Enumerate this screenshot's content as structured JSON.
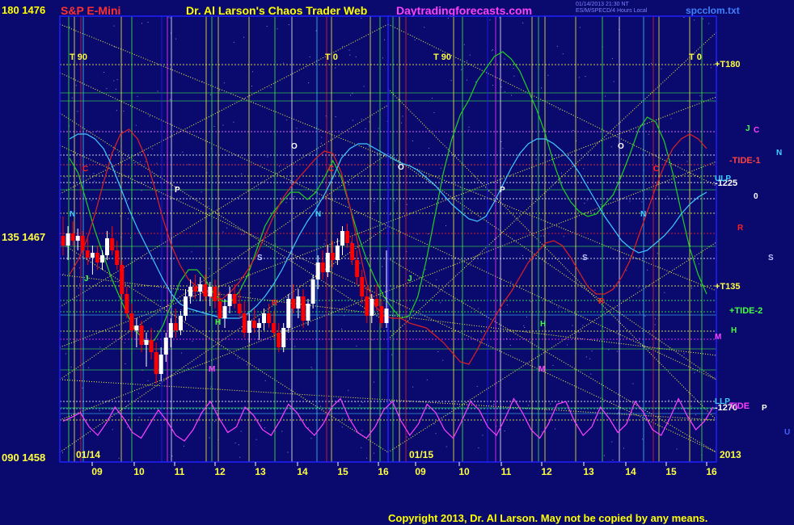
{
  "header": {
    "price_top": "180  1476",
    "instrument": "S&P E-Mini",
    "title": "Dr. Al Larson's Chaos Trader Web",
    "site": "Daytradingforecasts.com",
    "stamp_line1": "01/14/2013 21:30 NT",
    "stamp_line2": "ES/M/SPECD/4 Hours Local",
    "file": "spcclom.txt"
  },
  "footer": {
    "copyright": "Copyright 2013, Dr. Al Larson. May not be copied by any means."
  },
  "colors": {
    "background": "#0a0a6e",
    "bull_candle": "#ffffff",
    "bear_candle": "#ff0000",
    "grid_yellow": "#ffff40",
    "green_line": "#20d020",
    "red_line": "#e02020",
    "cyan_line": "#40c8ff",
    "magenta_osc": "#ff40ff"
  },
  "chart_data": {
    "type": "line",
    "left_axis": {
      "labels": [
        {
          "text": "180  1476",
          "value": 1476
        },
        {
          "text": "135  1467",
          "value": 1467
        },
        {
          "text": "090  1458",
          "value": 1458
        }
      ],
      "ylim": [
        1458,
        1476
      ]
    },
    "x_ticks": [
      "09",
      "10",
      "11",
      "12",
      "13",
      "14",
      "15",
      "16",
      "09",
      "10",
      "11",
      "12",
      "13",
      "14",
      "15",
      "16"
    ],
    "date_labels": [
      "01/14",
      "01/15"
    ],
    "year_label": "2013",
    "top_markers": [
      "T  90",
      "T  0",
      "T  90",
      "T  0"
    ],
    "right_levels": [
      {
        "label": "+T180",
        "color": "#ffff40"
      },
      {
        "label": "-TIDE-1",
        "color": "#ff4040"
      },
      {
        "label": "-1225",
        "color": "#ffffff"
      },
      {
        "label": "+T135",
        "color": "#ffff40"
      },
      {
        "label": "+TIDE-2",
        "color": "#40ff40"
      },
      {
        "label": "-1270",
        "color": "#ffffff"
      },
      {
        "label": "TIDE",
        "color": "#ff40ff"
      }
    ],
    "planet_labels_right": [
      {
        "text": "J",
        "color": "#40ff40"
      },
      {
        "text": "C",
        "color": "#ff40ff"
      },
      {
        "text": "N",
        "color": "#40d0ff"
      },
      {
        "text": "ULP",
        "color": "#40d0ff"
      },
      {
        "text": "0",
        "color": "#ffffff"
      },
      {
        "text": "R",
        "color": "#ff2020"
      },
      {
        "text": "S",
        "color": "#c0c0ff"
      },
      {
        "text": "H",
        "color": "#40ff40"
      },
      {
        "text": "M",
        "color": "#ff40ff"
      },
      {
        "text": "LLP",
        "color": "#40d0ff"
      },
      {
        "text": "P",
        "color": "#ffffff"
      },
      {
        "text": "U",
        "color": "#4060ff"
      }
    ],
    "chart_labels": [
      {
        "text": "C",
        "color": "#ff2020"
      },
      {
        "text": "P",
        "color": "#ffffff"
      },
      {
        "text": "N",
        "color": "#40d0ff"
      },
      {
        "text": "J",
        "color": "#40ff40"
      },
      {
        "text": "S",
        "color": "#c0c0ff"
      },
      {
        "text": "O",
        "color": "#ffffff"
      },
      {
        "text": "H",
        "color": "#40ff40"
      },
      {
        "text": "M",
        "color": "#ff40ff"
      },
      {
        "text": "R",
        "color": "#ff2020"
      },
      {
        "text": "C",
        "color": "#ff2020"
      },
      {
        "text": "N",
        "color": "#40d0ff"
      },
      {
        "text": "O",
        "color": "#ffffff"
      },
      {
        "text": "P",
        "color": "#ffffff"
      },
      {
        "text": "J",
        "color": "#40ff40"
      },
      {
        "text": "S",
        "color": "#c0c0ff"
      },
      {
        "text": "R",
        "color": "#ff2020"
      },
      {
        "text": "H",
        "color": "#40ff40"
      },
      {
        "text": "M",
        "color": "#ff40ff"
      },
      {
        "text": "O",
        "color": "#ffffff"
      },
      {
        "text": "N",
        "color": "#40d0ff"
      },
      {
        "text": "C",
        "color": "#ff2020"
      }
    ],
    "candles": [
      {
        "o": 1467.0,
        "h": 1467.8,
        "l": 1466.2,
        "c": 1466.6
      },
      {
        "o": 1466.6,
        "h": 1467.4,
        "l": 1466.0,
        "c": 1467.1
      },
      {
        "o": 1467.1,
        "h": 1467.6,
        "l": 1466.6,
        "c": 1466.8
      },
      {
        "o": 1466.8,
        "h": 1467.3,
        "l": 1466.4,
        "c": 1467.0
      },
      {
        "o": 1467.0,
        "h": 1467.2,
        "l": 1466.2,
        "c": 1466.4
      },
      {
        "o": 1466.4,
        "h": 1466.9,
        "l": 1465.8,
        "c": 1466.1
      },
      {
        "o": 1466.1,
        "h": 1466.6,
        "l": 1465.4,
        "c": 1466.3
      },
      {
        "o": 1466.3,
        "h": 1466.6,
        "l": 1465.6,
        "c": 1465.9
      },
      {
        "o": 1465.9,
        "h": 1466.4,
        "l": 1465.6,
        "c": 1466.2
      },
      {
        "o": 1466.2,
        "h": 1467.2,
        "l": 1466.0,
        "c": 1466.9
      },
      {
        "o": 1466.9,
        "h": 1467.4,
        "l": 1466.2,
        "c": 1466.4
      },
      {
        "o": 1466.4,
        "h": 1466.8,
        "l": 1465.6,
        "c": 1465.8
      },
      {
        "o": 1465.8,
        "h": 1466.0,
        "l": 1464.4,
        "c": 1464.6
      },
      {
        "o": 1464.6,
        "h": 1464.9,
        "l": 1463.6,
        "c": 1463.8
      },
      {
        "o": 1463.8,
        "h": 1464.2,
        "l": 1462.8,
        "c": 1463.1
      },
      {
        "o": 1463.1,
        "h": 1463.6,
        "l": 1462.4,
        "c": 1463.3
      },
      {
        "o": 1463.3,
        "h": 1463.5,
        "l": 1462.2,
        "c": 1462.5
      },
      {
        "o": 1462.5,
        "h": 1463.0,
        "l": 1461.6,
        "c": 1462.7
      },
      {
        "o": 1462.7,
        "h": 1463.2,
        "l": 1461.9,
        "c": 1462.2
      },
      {
        "o": 1462.2,
        "h": 1462.6,
        "l": 1460.9,
        "c": 1461.3
      },
      {
        "o": 1461.3,
        "h": 1462.4,
        "l": 1461.0,
        "c": 1462.1
      },
      {
        "o": 1462.1,
        "h": 1463.0,
        "l": 1461.8,
        "c": 1462.8
      },
      {
        "o": 1462.8,
        "h": 1463.6,
        "l": 1462.4,
        "c": 1463.4
      },
      {
        "o": 1463.4,
        "h": 1464.0,
        "l": 1462.8,
        "c": 1463.1
      },
      {
        "o": 1463.1,
        "h": 1463.9,
        "l": 1462.9,
        "c": 1463.7
      },
      {
        "o": 1463.7,
        "h": 1464.8,
        "l": 1463.5,
        "c": 1464.5
      },
      {
        "o": 1464.5,
        "h": 1465.2,
        "l": 1464.2,
        "c": 1464.9
      },
      {
        "o": 1464.9,
        "h": 1465.4,
        "l": 1464.4,
        "c": 1464.7
      },
      {
        "o": 1464.7,
        "h": 1465.3,
        "l": 1464.3,
        "c": 1465.0
      },
      {
        "o": 1465.0,
        "h": 1465.4,
        "l": 1464.3,
        "c": 1464.5
      },
      {
        "o": 1464.5,
        "h": 1465.1,
        "l": 1464.1,
        "c": 1464.9
      },
      {
        "o": 1464.9,
        "h": 1465.2,
        "l": 1464.0,
        "c": 1464.3
      },
      {
        "o": 1464.3,
        "h": 1464.7,
        "l": 1463.4,
        "c": 1463.6
      },
      {
        "o": 1463.6,
        "h": 1464.4,
        "l": 1463.2,
        "c": 1464.1
      },
      {
        "o": 1464.1,
        "h": 1464.9,
        "l": 1463.8,
        "c": 1464.6
      },
      {
        "o": 1464.6,
        "h": 1465.0,
        "l": 1464.0,
        "c": 1464.2
      },
      {
        "o": 1464.2,
        "h": 1464.8,
        "l": 1463.6,
        "c": 1463.8
      },
      {
        "o": 1463.8,
        "h": 1464.3,
        "l": 1462.8,
        "c": 1463.0
      },
      {
        "o": 1463.0,
        "h": 1463.8,
        "l": 1462.6,
        "c": 1463.5
      },
      {
        "o": 1463.5,
        "h": 1464.0,
        "l": 1463.0,
        "c": 1463.2
      },
      {
        "o": 1463.2,
        "h": 1463.6,
        "l": 1462.7,
        "c": 1463.4
      },
      {
        "o": 1463.4,
        "h": 1464.0,
        "l": 1463.1,
        "c": 1463.8
      },
      {
        "o": 1463.8,
        "h": 1464.2,
        "l": 1463.2,
        "c": 1463.4
      },
      {
        "o": 1463.4,
        "h": 1463.9,
        "l": 1462.8,
        "c": 1463.0
      },
      {
        "o": 1463.0,
        "h": 1463.4,
        "l": 1462.2,
        "c": 1462.4
      },
      {
        "o": 1462.4,
        "h": 1463.4,
        "l": 1462.2,
        "c": 1463.2
      },
      {
        "o": 1463.2,
        "h": 1464.6,
        "l": 1463.0,
        "c": 1464.4
      },
      {
        "o": 1464.4,
        "h": 1465.0,
        "l": 1463.8,
        "c": 1464.0
      },
      {
        "o": 1464.0,
        "h": 1464.8,
        "l": 1463.6,
        "c": 1464.5
      },
      {
        "o": 1464.5,
        "h": 1464.8,
        "l": 1463.2,
        "c": 1463.5
      },
      {
        "o": 1463.5,
        "h": 1464.4,
        "l": 1463.3,
        "c": 1464.2
      },
      {
        "o": 1464.2,
        "h": 1465.4,
        "l": 1464.0,
        "c": 1465.2
      },
      {
        "o": 1465.2,
        "h": 1466.2,
        "l": 1464.8,
        "c": 1465.9
      },
      {
        "o": 1465.9,
        "h": 1466.4,
        "l": 1465.2,
        "c": 1465.5
      },
      {
        "o": 1465.5,
        "h": 1466.6,
        "l": 1465.3,
        "c": 1466.3
      },
      {
        "o": 1466.3,
        "h": 1466.8,
        "l": 1465.7,
        "c": 1466.0
      },
      {
        "o": 1466.0,
        "h": 1466.9,
        "l": 1465.8,
        "c": 1466.6
      },
      {
        "o": 1466.6,
        "h": 1467.4,
        "l": 1466.2,
        "c": 1467.2
      },
      {
        "o": 1467.2,
        "h": 1467.5,
        "l": 1466.5,
        "c": 1466.7
      },
      {
        "o": 1466.7,
        "h": 1467.0,
        "l": 1465.8,
        "c": 1466.0
      },
      {
        "o": 1466.0,
        "h": 1466.4,
        "l": 1465.0,
        "c": 1465.3
      },
      {
        "o": 1465.3,
        "h": 1465.6,
        "l": 1464.2,
        "c": 1464.5
      },
      {
        "o": 1464.5,
        "h": 1464.9,
        "l": 1463.4,
        "c": 1463.7
      },
      {
        "o": 1463.7,
        "h": 1464.6,
        "l": 1463.4,
        "c": 1464.4
      },
      {
        "o": 1464.4,
        "h": 1465.0,
        "l": 1463.9,
        "c": 1464.1
      },
      {
        "o": 1464.1,
        "h": 1464.4,
        "l": 1463.2,
        "c": 1463.4
      },
      {
        "o": 1463.4,
        "h": 1466.4,
        "l": 1463.2,
        "c": 1464.0
      }
    ],
    "series": [
      {
        "color": "#20d020",
        "values": [
          1470.2,
          1469.6,
          1468.4,
          1467.2,
          1466.2,
          1465.2,
          1464.4,
          1463.6,
          1463.0,
          1462.6,
          1462.7,
          1463.3,
          1464.2,
          1465.1,
          1465.6,
          1465.6,
          1465.2,
          1464.6,
          1464.3,
          1464.3,
          1464.7,
          1465.4,
          1466.4,
          1467.4,
          1468.0,
          1468.4,
          1468.8,
          1468.8,
          1468.5,
          1468.8,
          1469.4,
          1470.1,
          1469.4,
          1468.2,
          1467.0,
          1466.0,
          1465.2,
          1464.5,
          1464.0,
          1463.6,
          1463.7,
          1464.5,
          1466.0,
          1467.8,
          1469.6,
          1471.0,
          1472.0,
          1472.6,
          1473.4,
          1473.9,
          1474.4,
          1474.6,
          1474.3,
          1473.8,
          1473.0,
          1472.2,
          1471.2,
          1470.0,
          1469.0,
          1468.4,
          1468.0,
          1467.8,
          1467.9,
          1468.3,
          1468.7,
          1469.5,
          1470.4,
          1471.4,
          1471.9,
          1471.7,
          1470.9,
          1469.6,
          1468.0,
          1466.5,
          1465.4,
          1464.6
        ]
      },
      {
        "color": "#e02020",
        "values": [
          1465.4,
          1466.0,
          1466.8,
          1467.9,
          1469.2,
          1470.4,
          1471.2,
          1471.4,
          1471.0,
          1470.2,
          1469.0,
          1467.7,
          1466.6,
          1465.8,
          1465.2,
          1464.9,
          1464.6,
          1464.4,
          1464.4,
          1464.7,
          1465.1,
          1465.6,
          1466.2,
          1467.0,
          1467.8,
          1468.5,
          1469.0,
          1469.4,
          1469.8,
          1470.2,
          1470.5,
          1470.4,
          1469.6,
          1468.2,
          1466.6,
          1465.0,
          1464.1,
          1463.7,
          1463.6,
          1463.6,
          1463.4,
          1463.3,
          1463.2,
          1462.9,
          1462.6,
          1462.2,
          1461.8,
          1461.7,
          1462.3,
          1463.0,
          1463.6,
          1464.2,
          1464.7,
          1465.3,
          1465.9,
          1466.3,
          1466.7,
          1466.8,
          1466.6,
          1466.1,
          1465.5,
          1464.9,
          1464.6,
          1464.6,
          1464.8,
          1465.3,
          1466.0,
          1467.0,
          1468.0,
          1469.0,
          1469.9,
          1470.6,
          1471.0,
          1471.2,
          1471.0,
          1470.6
        ]
      },
      {
        "color": "#40c8ff",
        "values": [
          1471.0,
          1471.2,
          1471.2,
          1471.0,
          1470.6,
          1469.9,
          1469.0,
          1468.1,
          1467.3,
          1466.6,
          1465.9,
          1465.2,
          1464.6,
          1464.2,
          1464.0,
          1463.9,
          1463.8,
          1463.7,
          1463.6,
          1463.6,
          1463.6,
          1463.8,
          1464.1,
          1464.5,
          1465.0,
          1465.6,
          1466.3,
          1467.0,
          1467.6,
          1468.1,
          1468.7,
          1469.4,
          1470.2,
          1470.6,
          1470.8,
          1470.8,
          1470.6,
          1470.4,
          1470.2,
          1470.0,
          1469.9,
          1469.7,
          1469.4,
          1469.1,
          1468.7,
          1468.3,
          1468.0,
          1467.7,
          1467.6,
          1467.8,
          1468.4,
          1469.1,
          1469.8,
          1470.4,
          1470.8,
          1471.0,
          1471.0,
          1470.8,
          1470.5,
          1470.1,
          1469.6,
          1469.0,
          1468.4,
          1467.8,
          1467.3,
          1466.8,
          1466.5,
          1466.3,
          1466.4,
          1466.7,
          1467.0,
          1467.4,
          1467.9,
          1468.3,
          1468.6,
          1468.8
        ]
      }
    ],
    "oscillator": [
      0.55,
      0.62,
      0.7,
      0.45,
      0.3,
      0.52,
      0.8,
      0.6,
      0.35,
      0.25,
      0.5,
      0.75,
      0.55,
      0.3,
      0.2,
      0.4,
      0.7,
      0.9,
      0.6,
      0.35,
      0.45,
      0.8,
      0.65,
      0.4,
      0.3,
      0.55,
      0.85,
      0.7,
      0.45,
      0.3,
      0.5,
      0.8,
      0.95,
      0.6,
      0.35,
      0.25,
      0.45,
      0.75,
      0.9,
      0.55,
      0.3,
      0.5,
      0.85,
      0.7,
      0.4,
      0.25,
      0.55,
      0.9,
      0.75,
      0.45,
      0.3,
      0.6,
      0.95,
      0.7,
      0.4,
      0.25,
      0.5,
      0.85,
      0.9,
      0.55,
      0.3,
      0.45,
      0.8,
      0.6,
      0.35,
      0.5,
      0.9,
      0.7,
      0.4,
      0.3,
      0.6,
      0.95,
      0.65,
      0.4,
      0.55,
      0.8
    ]
  }
}
